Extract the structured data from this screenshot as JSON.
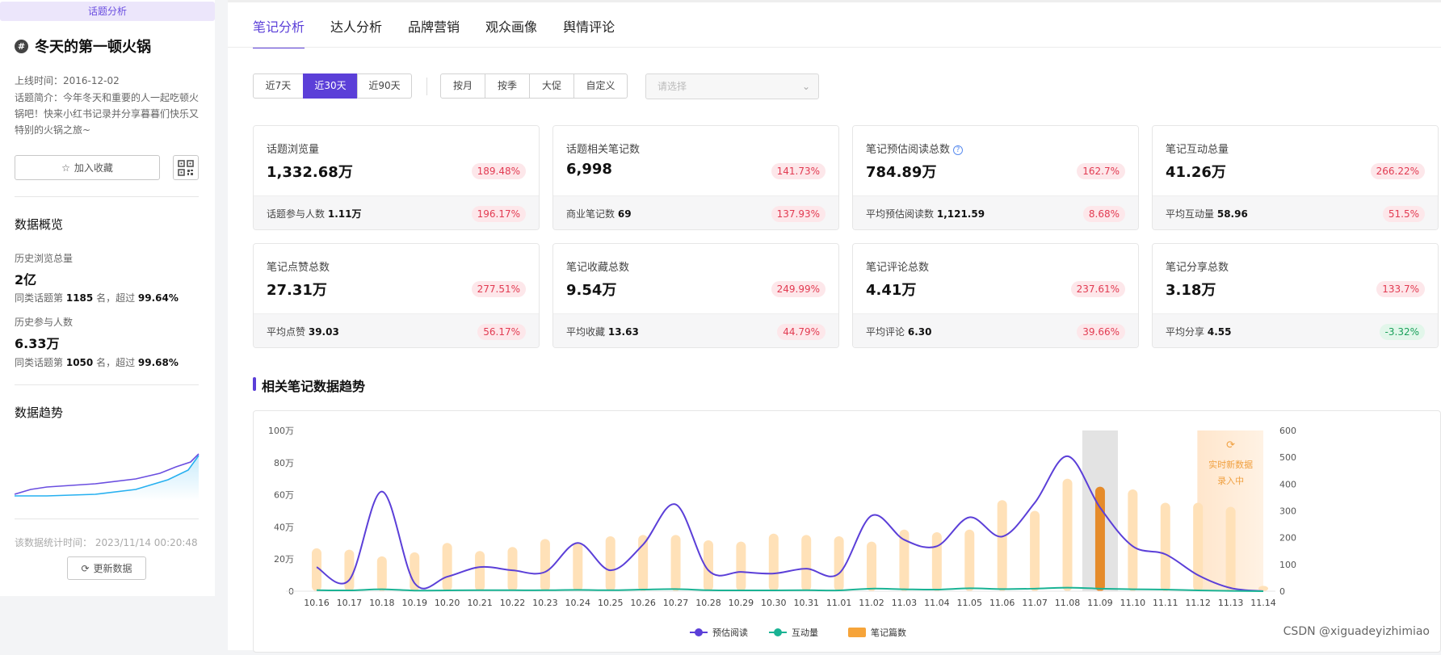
{
  "sidebar": {
    "tag": "话题分析",
    "topic_title": "冬天的第一顿火锅",
    "online_time": "上线时间：2016-12-02",
    "intro": "话题简介：今年冬天和重要的人一起吃顿火锅吧！快来小红书记录并分享暮暮们快乐又特别的火锅之旅~",
    "favorite_label": "加入收藏",
    "overview_title": "数据概览",
    "hist_views_label": "历史浏览总量",
    "hist_views_value": "2亿",
    "hist_views_rank_prefix": "同类话题第",
    "hist_views_rank": "1185",
    "hist_views_rank_mid": "名，超过",
    "hist_views_pct": "99.64%",
    "hist_people_label": "历史参与人数",
    "hist_people_value": "6.33万",
    "hist_people_rank_prefix": "同类话题第",
    "hist_people_rank": "1050",
    "hist_people_rank_mid": "名，超过",
    "hist_people_pct": "99.68%",
    "trend_title": "数据趋势",
    "stat_time": "该数据统计时间：  2023/11/14 00:20:48",
    "refresh_label": "更新数据",
    "colors": {
      "purple": "#6a4ee0",
      "blue": "#26b0f0"
    }
  },
  "tabs": [
    "笔记分析",
    "达人分析",
    "品牌营销",
    "观众画像",
    "舆情评论"
  ],
  "filters": {
    "range": [
      "近7天",
      "近30天",
      "近90天"
    ],
    "range_selected": "近30天",
    "period": [
      "按月",
      "按季",
      "大促",
      "自定义"
    ],
    "select_placeholder": "请选择"
  },
  "cards": [
    {
      "label": "话题浏览量",
      "value": "1,332.68万",
      "pct": "189.48%",
      "sub_label": "话题参与人数",
      "sub_value": "1.11万",
      "sub_pct": "196.17%",
      "sub_pct_green": false,
      "help": false
    },
    {
      "label": "话题相关笔记数",
      "value": "6,998",
      "pct": "141.73%",
      "sub_label": "商业笔记数",
      "sub_value": "69",
      "sub_pct": "137.93%",
      "sub_pct_green": false,
      "help": false
    },
    {
      "label": "笔记预估阅读总数",
      "value": "784.89万",
      "pct": "162.7%",
      "sub_label": "平均预估阅读数",
      "sub_value": "1,121.59",
      "sub_pct": "8.68%",
      "sub_pct_green": false,
      "help": true
    },
    {
      "label": "笔记互动总量",
      "value": "41.26万",
      "pct": "266.22%",
      "sub_label": "平均互动量",
      "sub_value": "58.96",
      "sub_pct": "51.5%",
      "sub_pct_green": false,
      "help": false
    },
    {
      "label": "笔记点赞总数",
      "value": "27.31万",
      "pct": "277.51%",
      "sub_label": "平均点赞",
      "sub_value": "39.03",
      "sub_pct": "56.17%",
      "sub_pct_green": false,
      "help": false
    },
    {
      "label": "笔记收藏总数",
      "value": "9.54万",
      "pct": "249.99%",
      "sub_label": "平均收藏",
      "sub_value": "13.63",
      "sub_pct": "44.79%",
      "sub_pct_green": false,
      "help": false
    },
    {
      "label": "笔记评论总数",
      "value": "4.41万",
      "pct": "237.61%",
      "sub_label": "平均评论",
      "sub_value": "6.30",
      "sub_pct": "39.66%",
      "sub_pct_green": false,
      "help": false
    },
    {
      "label": "笔记分享总数",
      "value": "3.18万",
      "pct": "133.7%",
      "sub_label": "平均分享",
      "sub_value": "4.55",
      "sub_pct": "-3.32%",
      "sub_pct_green": true,
      "help": false
    }
  ],
  "section_title": "相关笔记数据趋势",
  "realtime_note": [
    "实时新数据",
    "录入中"
  ],
  "watermark": "CSDN @xiguadeyizhimiao",
  "chart_data": {
    "type": "bar+line",
    "categories": [
      "10.16",
      "10.17",
      "10.18",
      "10.19",
      "10.20",
      "10.21",
      "10.22",
      "10.23",
      "10.24",
      "10.25",
      "10.26",
      "10.27",
      "10.28",
      "10.29",
      "10.30",
      "10.31",
      "11.01",
      "11.02",
      "11.03",
      "11.04",
      "11.05",
      "11.06",
      "11.07",
      "11.08",
      "11.09",
      "11.10",
      "11.11",
      "11.12",
      "11.13",
      "11.14"
    ],
    "left_axis_ticks": [
      "0",
      "20万",
      "40万",
      "60万",
      "80万",
      "100万"
    ],
    "left_axis_max": 1000000,
    "right_axis_ticks": [
      "0",
      "100",
      "200",
      "300",
      "400",
      "500",
      "600"
    ],
    "right_axis_max": 600,
    "highlight_category": "11.09",
    "series": [
      {
        "name": "预估阅读",
        "axis": "left",
        "kind": "line",
        "color": "#5b3fd8",
        "values": [
          150000,
          70000,
          620000,
          50000,
          90000,
          150000,
          130000,
          120000,
          300000,
          130000,
          290000,
          540000,
          130000,
          120000,
          110000,
          140000,
          110000,
          470000,
          320000,
          280000,
          460000,
          340000,
          550000,
          840000,
          520000,
          280000,
          230000,
          100000,
          20000,
          0
        ]
      },
      {
        "name": "互动量",
        "axis": "left",
        "kind": "line",
        "color": "#1ab394",
        "values": [
          6000,
          5000,
          12000,
          4000,
          5000,
          6000,
          6000,
          6000,
          8000,
          6000,
          10000,
          13000,
          6000,
          5000,
          5000,
          6000,
          5000,
          16000,
          12000,
          10000,
          18000,
          13000,
          16000,
          22000,
          16000,
          12000,
          10000,
          5000,
          2000,
          0
        ]
      },
      {
        "name": "笔记篇数",
        "axis": "right",
        "kind": "bar",
        "color": "#ffe1b8",
        "highlight_color": "#e58b2a",
        "values": [
          160,
          155,
          130,
          145,
          180,
          150,
          165,
          195,
          180,
          205,
          210,
          210,
          190,
          185,
          215,
          210,
          205,
          185,
          230,
          220,
          230,
          340,
          300,
          420,
          390,
          380,
          330,
          330,
          315,
          20
        ]
      }
    ]
  }
}
